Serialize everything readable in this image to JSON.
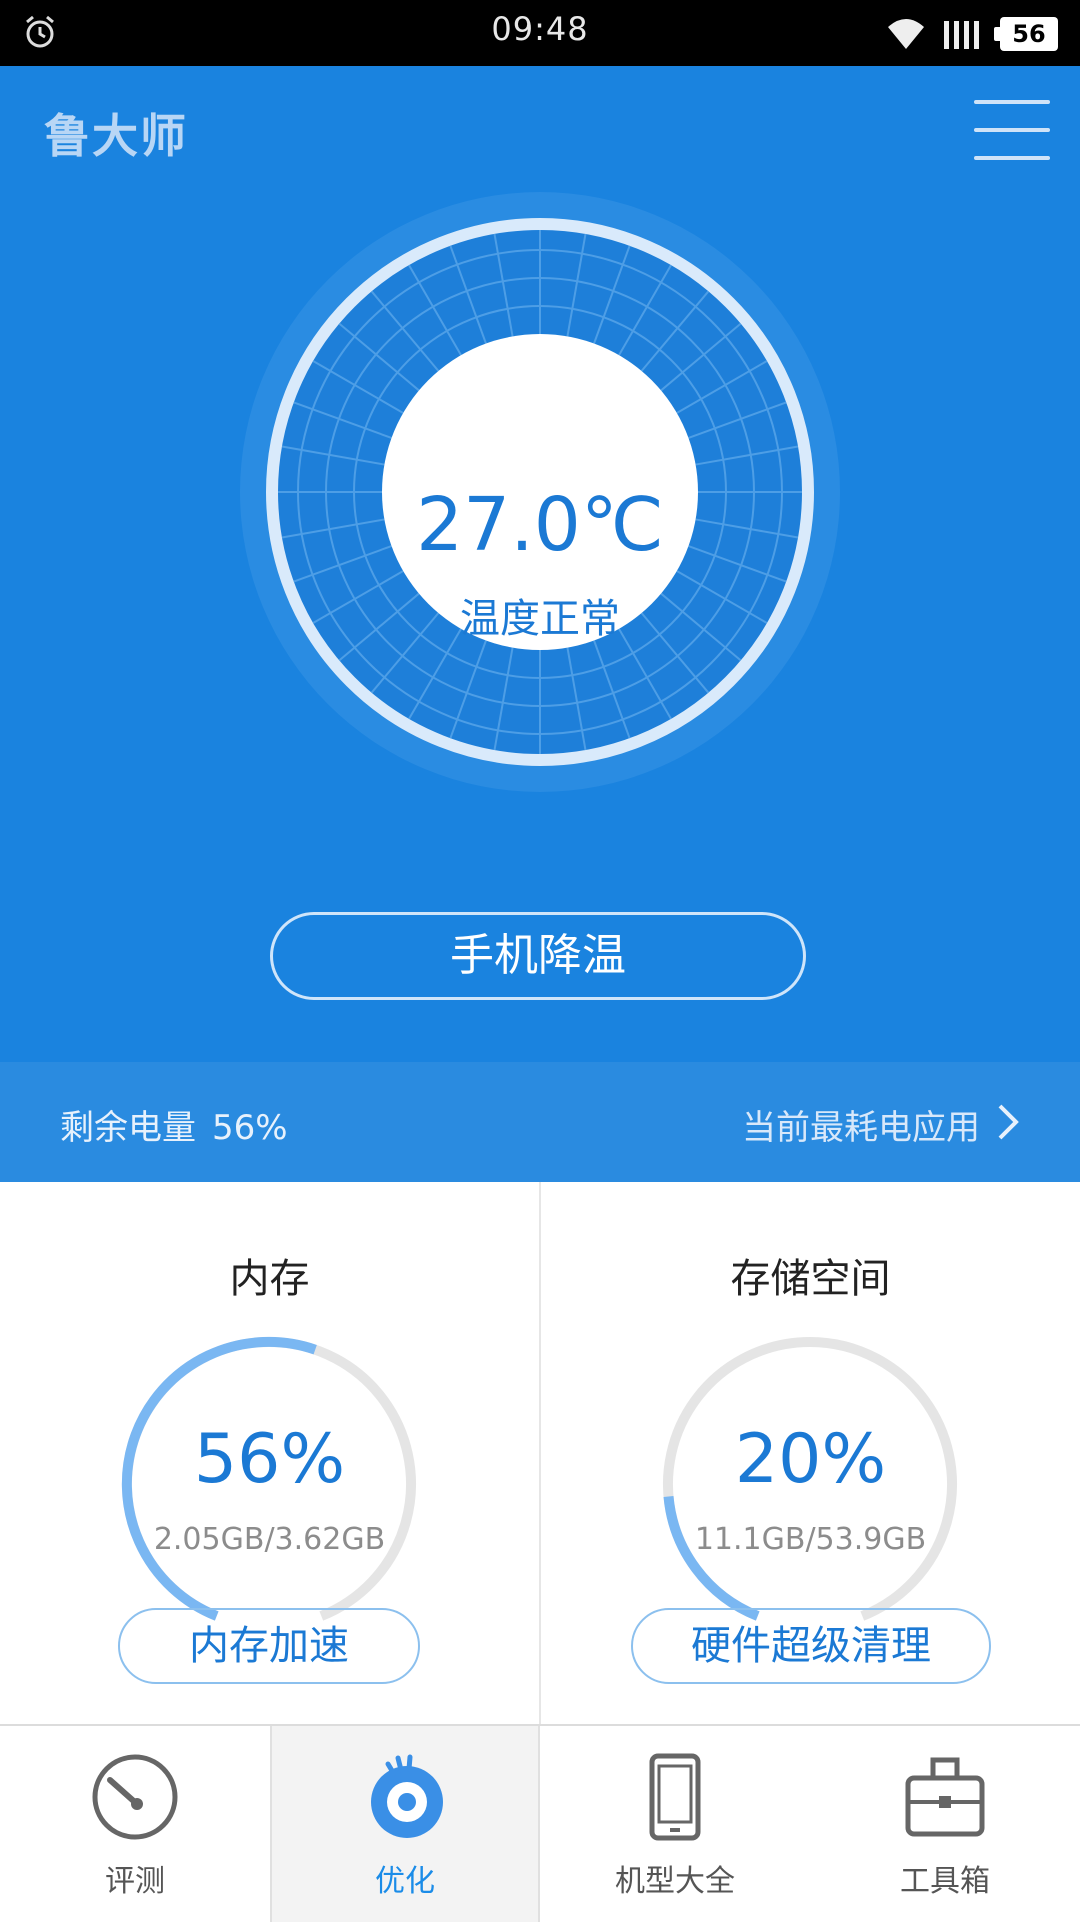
{
  "status_bar": {
    "time": "09:48",
    "battery": "56",
    "icons": [
      "alarm-icon",
      "wifi-icon",
      "signal-icon",
      "battery-icon"
    ]
  },
  "header": {
    "logo": "鲁大师",
    "menu_icon": "hamburger-menu-icon"
  },
  "temperature": {
    "value": "27.0℃",
    "status": "温度正常"
  },
  "cooling_button": "手机降温",
  "battery_strip": {
    "label": "剩余电量",
    "percent": "56%",
    "link": "当前最耗电应用"
  },
  "memory": {
    "title": "内存",
    "percent": "56%",
    "usage": "2.05GB/3.62GB",
    "fraction": 0.56,
    "button": "内存加速"
  },
  "storage": {
    "title": "存储空间",
    "percent": "20%",
    "usage": "11.1GB/53.9GB",
    "fraction": 0.2,
    "button": "硬件超级清理"
  },
  "nav": [
    {
      "label": "评测",
      "icon": "speedometer-icon",
      "active": false
    },
    {
      "label": "优化",
      "icon": "optimize-disc-icon",
      "active": true
    },
    {
      "label": "机型大全",
      "icon": "phone-icon",
      "active": false
    },
    {
      "label": "工具箱",
      "icon": "toolbox-icon",
      "active": false
    }
  ],
  "colors": {
    "primary": "#1a83df",
    "accent": "#1b79d4",
    "nav_active": "#1b8ce8",
    "arc_fill": "#7ab7f2",
    "arc_track": "#e5e5e5"
  }
}
